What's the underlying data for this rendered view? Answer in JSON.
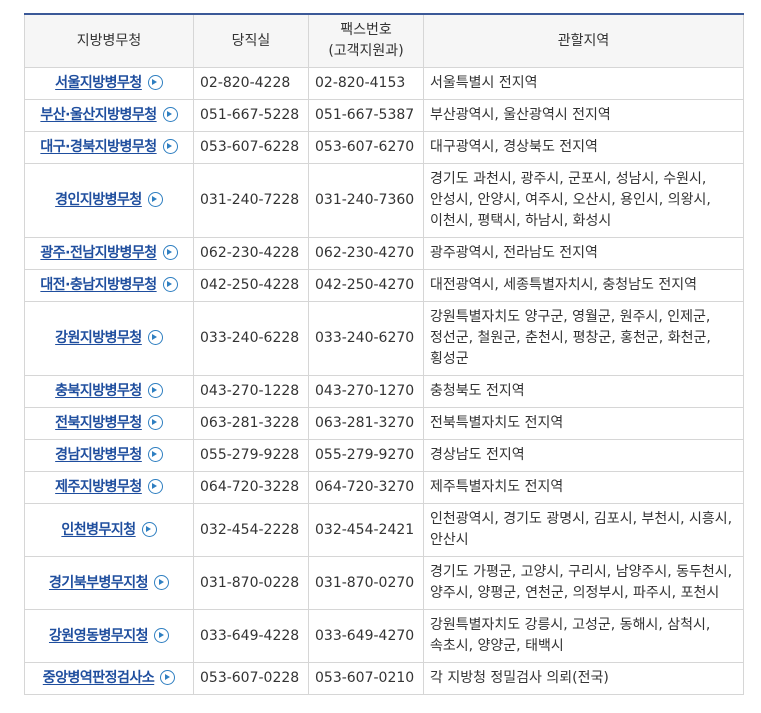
{
  "table": {
    "headers": {
      "office": "지방병무청",
      "duty_room": "당직실",
      "fax_line1": "팩스번호",
      "fax_line2": "(고객지원과)",
      "region": "관할지역"
    },
    "rows": [
      {
        "office": "서울지방병무청",
        "duty": "02-820-4228",
        "fax": "02-820-4153",
        "region": "서울특별시 전지역"
      },
      {
        "office": "부산·울산지방병무청",
        "duty": "051-667-5228",
        "fax": "051-667-5387",
        "region": "부산광역시, 울산광역시 전지역"
      },
      {
        "office": "대구·경북지방병무청",
        "duty": "053-607-6228",
        "fax": "053-607-6270",
        "region": "대구광역시, 경상북도 전지역"
      },
      {
        "office": "경인지방병무청",
        "duty": "031-240-7228",
        "fax": "031-240-7360",
        "region": "경기도 과천시, 광주시, 군포시, 성남시, 수원시, 안성시, 안양시, 여주시, 오산시, 용인시, 의왕시, 이천시, 평택시, 하남시, 화성시"
      },
      {
        "office": "광주·전남지방병무청",
        "duty": "062-230-4228",
        "fax": "062-230-4270",
        "region": "광주광역시, 전라남도 전지역"
      },
      {
        "office": "대전·충남지방병무청",
        "duty": "042-250-4228",
        "fax": "042-250-4270",
        "region": "대전광역시, 세종특별자치시, 충청남도 전지역"
      },
      {
        "office": "강원지방병무청",
        "duty": "033-240-6228",
        "fax": "033-240-6270",
        "region": "강원특별자치도 양구군, 영월군, 원주시, 인제군, 정선군, 철원군, 춘천시, 평창군, 홍천군, 화천군, 횡성군"
      },
      {
        "office": "충북지방병무청",
        "duty": "043-270-1228",
        "fax": "043-270-1270",
        "region": "충청북도 전지역"
      },
      {
        "office": "전북지방병무청",
        "duty": "063-281-3228",
        "fax": "063-281-3270",
        "region": "전북특별자치도 전지역"
      },
      {
        "office": "경남지방병무청",
        "duty": "055-279-9228",
        "fax": "055-279-9270",
        "region": "경상남도 전지역"
      },
      {
        "office": "제주지방병무청",
        "duty": "064-720-3228",
        "fax": "064-720-3270",
        "region": "제주특별자치도 전지역"
      },
      {
        "office": "인천병무지청",
        "duty": "032-454-2228",
        "fax": "032-454-2421",
        "region": "인천광역시, 경기도 광명시, 김포시, 부천시, 시흥시, 안산시"
      },
      {
        "office": "경기북부병무지청",
        "duty": "031-870-0228",
        "fax": "031-870-0270",
        "region": "경기도 가평군, 고양시, 구리시, 남양주시, 동두천시, 양주시, 양평군, 연천군, 의정부시, 파주시, 포천시"
      },
      {
        "office": "강원영동병무지청",
        "duty": "033-649-4228",
        "fax": "033-649-4270",
        "region": "강원특별자치도 강릉시, 고성군, 동해시, 삼척시, 속초시, 양양군, 태백시"
      },
      {
        "office": "중앙병역판정검사소",
        "duty": "053-607-0228",
        "fax": "053-607-0210",
        "region": "각 지방청 정밀검사 의뢰(전국)"
      }
    ]
  }
}
